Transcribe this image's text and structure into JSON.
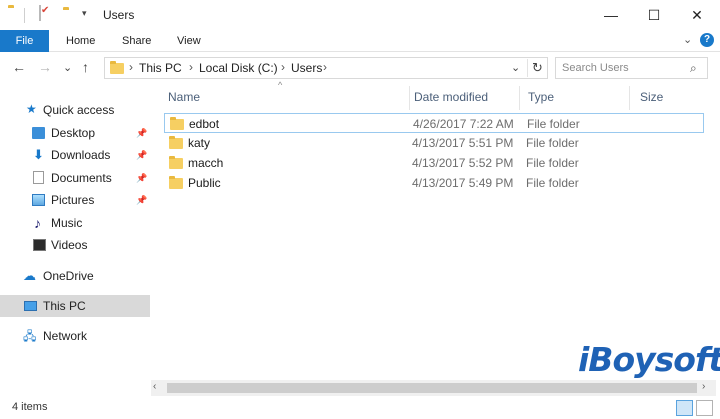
{
  "window": {
    "title": "Users",
    "qat_dropdown": "▾",
    "minimize": "—",
    "maximize": "☐",
    "close": "✕"
  },
  "ribbon": {
    "tabs": [
      "File",
      "Home",
      "Share",
      "View"
    ],
    "expand": "⌄",
    "help": "?"
  },
  "nav": {
    "back": "←",
    "forward": "→",
    "recent": "⌄",
    "up": "↑",
    "breadcrumb": [
      "This PC",
      "Local Disk (C:)",
      "Users"
    ],
    "separator": "›",
    "dropdown": "⌄",
    "refresh": "↻",
    "search_placeholder": "Search Users",
    "search_icon": "⌕"
  },
  "sidebar": {
    "items": [
      {
        "label": "Quick access",
        "icon": "star-icon",
        "pinned": false
      },
      {
        "label": "Desktop",
        "icon": "desktop-icon",
        "pinned": true
      },
      {
        "label": "Downloads",
        "icon": "downloads-icon",
        "pinned": true
      },
      {
        "label": "Documents",
        "icon": "documents-icon",
        "pinned": true
      },
      {
        "label": "Pictures",
        "icon": "pictures-icon",
        "pinned": true
      },
      {
        "label": "Music",
        "icon": "music-icon",
        "pinned": false
      },
      {
        "label": "Videos",
        "icon": "videos-icon",
        "pinned": false
      },
      {
        "label": "OneDrive",
        "icon": "onedrive-icon",
        "pinned": false
      },
      {
        "label": "This PC",
        "icon": "this-pc-icon",
        "pinned": false,
        "selected": true
      },
      {
        "label": "Network",
        "icon": "network-icon",
        "pinned": false
      }
    ],
    "pin_glyph": "📌"
  },
  "files": {
    "columns": [
      "Name",
      "Date modified",
      "Type",
      "Size"
    ],
    "sort_glyph": "^",
    "rows": [
      {
        "name": "edbot",
        "date": "4/26/2017 7:22 AM",
        "type": "File folder"
      },
      {
        "name": "katy",
        "date": "4/13/2017 5:51 PM",
        "type": "File folder"
      },
      {
        "name": "macch",
        "date": "4/13/2017 5:52 PM",
        "type": "File folder"
      },
      {
        "name": "Public",
        "date": "4/13/2017 5:49 PM",
        "type": "File folder"
      }
    ]
  },
  "watermark": "iBoysoft",
  "scroll": {
    "left": "‹",
    "right": "›"
  },
  "status": {
    "items_count": "4 items"
  },
  "colors": {
    "accent": "#1979ca",
    "folder": "#f6cf62",
    "selection": "#d9d9d9",
    "watermark": "#1f62b5"
  }
}
